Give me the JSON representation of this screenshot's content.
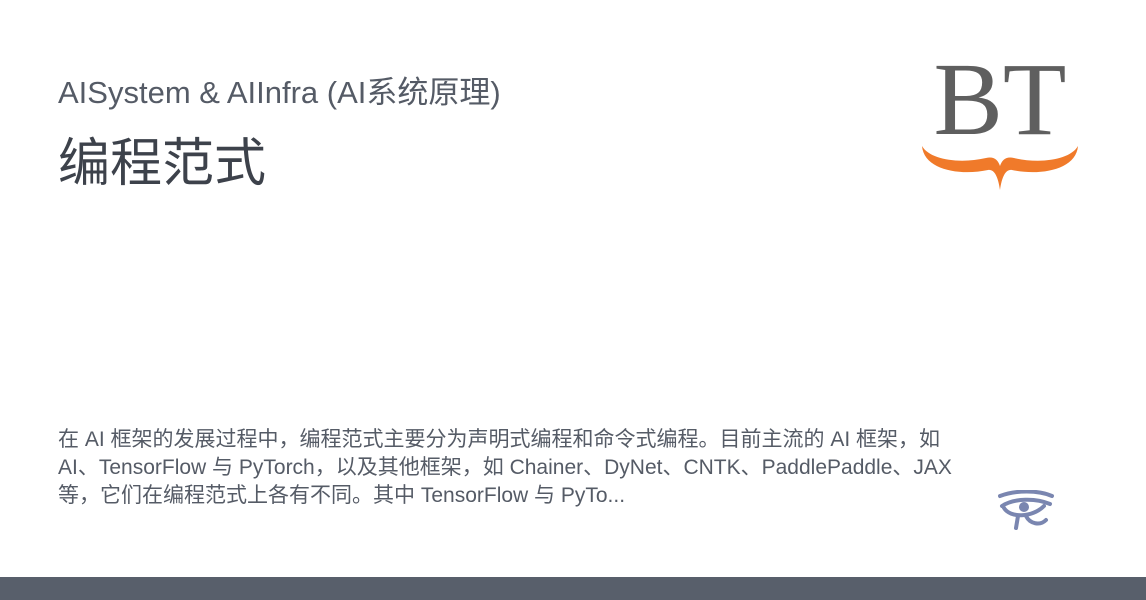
{
  "header": {
    "site_title": "AISystem & AIInfra (AI系统原理)",
    "page_title": "编程范式"
  },
  "logo": {
    "text": "BT",
    "text_color": "#5f5f5f",
    "brace_color": "#f07a2a"
  },
  "description": {
    "text": "在 AI 框架的发展过程中，编程范式主要分为声明式编程和命令式编程。目前主流的 AI 框架，如 AI、TensorFlow 与 PyTorch，以及其他框架，如 Chainer、DyNet、CNTK、PaddlePaddle、JAX 等，它们在编程范式上各有不同。其中 TensorFlow 与 PyTo..."
  },
  "eye_mark": {
    "name": "eye-of-horus",
    "color": "#7a86b0"
  },
  "footer": {
    "color": "#585f6b"
  }
}
